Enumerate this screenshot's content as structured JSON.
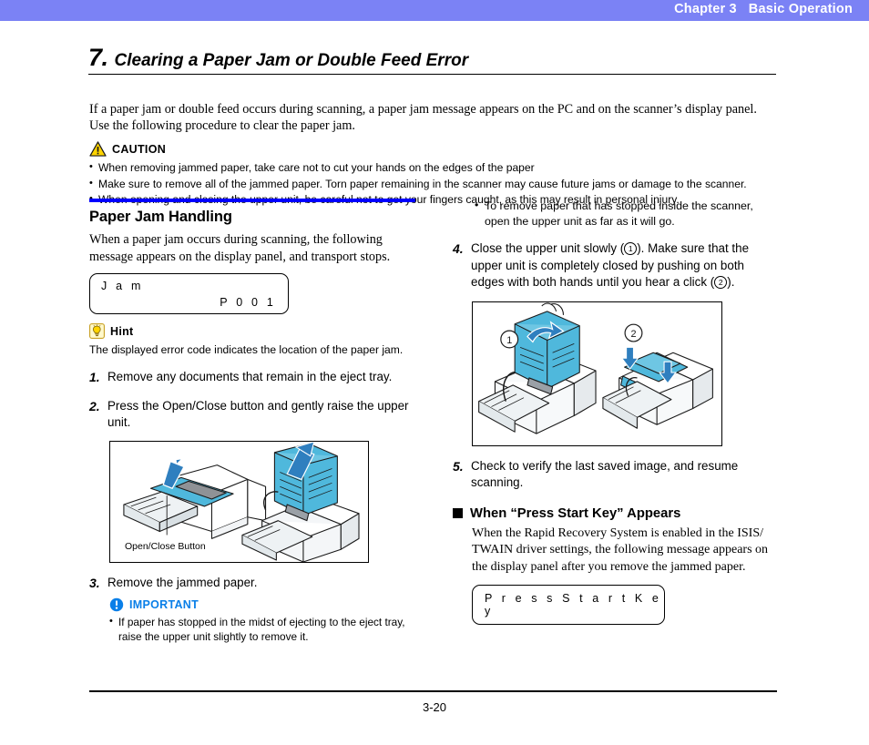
{
  "header": {
    "chapter": "Chapter 3",
    "title": "Basic Operation"
  },
  "section": {
    "number": "7.",
    "title": "Clearing a Paper Jam or Double Feed Error",
    "intro": "If a paper jam or double feed occurs during scanning, a paper jam message appears on the PC and on the scanner’s display panel. Use the following procedure to clear the paper jam."
  },
  "caution": {
    "icon": "warning-triangle-icon",
    "label": "CAUTION",
    "items": [
      "When removing jammed paper, take care not to cut your hands on the edges of the paper",
      "Make sure to remove all of the jammed paper. Torn paper remaining in the scanner may cause future jams or damage to the scanner.",
      "When opening and closing the upper unit, be careful not to get your fingers caught, as this may result in personal injury."
    ]
  },
  "left_column": {
    "subsection_title": "Paper Jam Handling",
    "intro": "When a paper jam occurs during scanning, the following message appears on the display panel, and transport stops.",
    "lcd_jam": {
      "line1": "J a m",
      "line2": "P 0 0 1"
    },
    "hint": {
      "icon": "lightbulb-icon",
      "label": "Hint",
      "text": "The displayed error code indicates the location of the paper jam."
    },
    "steps": [
      {
        "number": "1.",
        "text": "Remove any documents that remain in the eject tray."
      },
      {
        "number": "2.",
        "text": "Press the Open/Close button and gently raise the upper unit."
      },
      {
        "number": "3.",
        "text": "Remove the jammed paper."
      }
    ],
    "figure_caption": "Open/Close Button",
    "important": {
      "icon": "exclamation-circle-icon",
      "label": "IMPORTANT",
      "items": [
        "If paper has stopped in the midst of ejecting to the eject tray, raise the upper unit slightly to remove it."
      ]
    }
  },
  "right_column": {
    "bullet": "To remove paper that has stopped inside the scanner, open the upper unit as far as it will go.",
    "step4": {
      "number": "4.",
      "part1": "Close the upper unit slowly (",
      "mark1": "1",
      "part2": "). Make sure that the upper unit is completely closed by pushing on both edges with both hands until you hear a click (",
      "mark2": "2",
      "part3": ")."
    },
    "figure_marks": {
      "mark1": "1",
      "mark2": "2"
    },
    "step5": {
      "number": "5.",
      "text": "Check to verify the last saved image, and resume scanning."
    },
    "subhead": "When “Press Start Key” Appears",
    "subhead_para": "When the Rapid Recovery System is enabled in the ISIS/ TWAIN driver settings, the following message appears on the display panel after you remove the jammed paper.",
    "lcd_press": {
      "line1": "P r e s s    S t a r t    K e y"
    }
  },
  "footer": {
    "page_number": "3-20"
  },
  "colors": {
    "header_bar": "#7b82f5",
    "accent_rule": "#0000ff",
    "important_blue": "#0a7fe8",
    "caution_yellow": "#ffd400",
    "illustration_cyan": "#4fb8dc"
  }
}
